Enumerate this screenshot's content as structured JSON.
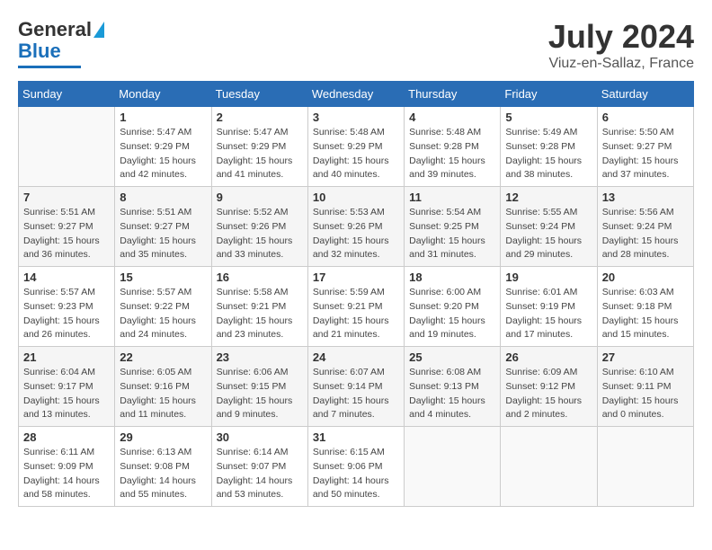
{
  "header": {
    "logo": {
      "line1": "General",
      "line2": "Blue"
    },
    "title": "July 2024",
    "location": "Viuz-en-Sallaz, France"
  },
  "days_of_week": [
    "Sunday",
    "Monday",
    "Tuesday",
    "Wednesday",
    "Thursday",
    "Friday",
    "Saturday"
  ],
  "weeks": [
    [
      {
        "day": "",
        "info": ""
      },
      {
        "day": "1",
        "info": "Sunrise: 5:47 AM\nSunset: 9:29 PM\nDaylight: 15 hours\nand 42 minutes."
      },
      {
        "day": "2",
        "info": "Sunrise: 5:47 AM\nSunset: 9:29 PM\nDaylight: 15 hours\nand 41 minutes."
      },
      {
        "day": "3",
        "info": "Sunrise: 5:48 AM\nSunset: 9:29 PM\nDaylight: 15 hours\nand 40 minutes."
      },
      {
        "day": "4",
        "info": "Sunrise: 5:48 AM\nSunset: 9:28 PM\nDaylight: 15 hours\nand 39 minutes."
      },
      {
        "day": "5",
        "info": "Sunrise: 5:49 AM\nSunset: 9:28 PM\nDaylight: 15 hours\nand 38 minutes."
      },
      {
        "day": "6",
        "info": "Sunrise: 5:50 AM\nSunset: 9:27 PM\nDaylight: 15 hours\nand 37 minutes."
      }
    ],
    [
      {
        "day": "7",
        "info": "Sunrise: 5:51 AM\nSunset: 9:27 PM\nDaylight: 15 hours\nand 36 minutes."
      },
      {
        "day": "8",
        "info": "Sunrise: 5:51 AM\nSunset: 9:27 PM\nDaylight: 15 hours\nand 35 minutes."
      },
      {
        "day": "9",
        "info": "Sunrise: 5:52 AM\nSunset: 9:26 PM\nDaylight: 15 hours\nand 33 minutes."
      },
      {
        "day": "10",
        "info": "Sunrise: 5:53 AM\nSunset: 9:26 PM\nDaylight: 15 hours\nand 32 minutes."
      },
      {
        "day": "11",
        "info": "Sunrise: 5:54 AM\nSunset: 9:25 PM\nDaylight: 15 hours\nand 31 minutes."
      },
      {
        "day": "12",
        "info": "Sunrise: 5:55 AM\nSunset: 9:24 PM\nDaylight: 15 hours\nand 29 minutes."
      },
      {
        "day": "13",
        "info": "Sunrise: 5:56 AM\nSunset: 9:24 PM\nDaylight: 15 hours\nand 28 minutes."
      }
    ],
    [
      {
        "day": "14",
        "info": "Sunrise: 5:57 AM\nSunset: 9:23 PM\nDaylight: 15 hours\nand 26 minutes."
      },
      {
        "day": "15",
        "info": "Sunrise: 5:57 AM\nSunset: 9:22 PM\nDaylight: 15 hours\nand 24 minutes."
      },
      {
        "day": "16",
        "info": "Sunrise: 5:58 AM\nSunset: 9:21 PM\nDaylight: 15 hours\nand 23 minutes."
      },
      {
        "day": "17",
        "info": "Sunrise: 5:59 AM\nSunset: 9:21 PM\nDaylight: 15 hours\nand 21 minutes."
      },
      {
        "day": "18",
        "info": "Sunrise: 6:00 AM\nSunset: 9:20 PM\nDaylight: 15 hours\nand 19 minutes."
      },
      {
        "day": "19",
        "info": "Sunrise: 6:01 AM\nSunset: 9:19 PM\nDaylight: 15 hours\nand 17 minutes."
      },
      {
        "day": "20",
        "info": "Sunrise: 6:03 AM\nSunset: 9:18 PM\nDaylight: 15 hours\nand 15 minutes."
      }
    ],
    [
      {
        "day": "21",
        "info": "Sunrise: 6:04 AM\nSunset: 9:17 PM\nDaylight: 15 hours\nand 13 minutes."
      },
      {
        "day": "22",
        "info": "Sunrise: 6:05 AM\nSunset: 9:16 PM\nDaylight: 15 hours\nand 11 minutes."
      },
      {
        "day": "23",
        "info": "Sunrise: 6:06 AM\nSunset: 9:15 PM\nDaylight: 15 hours\nand 9 minutes."
      },
      {
        "day": "24",
        "info": "Sunrise: 6:07 AM\nSunset: 9:14 PM\nDaylight: 15 hours\nand 7 minutes."
      },
      {
        "day": "25",
        "info": "Sunrise: 6:08 AM\nSunset: 9:13 PM\nDaylight: 15 hours\nand 4 minutes."
      },
      {
        "day": "26",
        "info": "Sunrise: 6:09 AM\nSunset: 9:12 PM\nDaylight: 15 hours\nand 2 minutes."
      },
      {
        "day": "27",
        "info": "Sunrise: 6:10 AM\nSunset: 9:11 PM\nDaylight: 15 hours\nand 0 minutes."
      }
    ],
    [
      {
        "day": "28",
        "info": "Sunrise: 6:11 AM\nSunset: 9:09 PM\nDaylight: 14 hours\nand 58 minutes."
      },
      {
        "day": "29",
        "info": "Sunrise: 6:13 AM\nSunset: 9:08 PM\nDaylight: 14 hours\nand 55 minutes."
      },
      {
        "day": "30",
        "info": "Sunrise: 6:14 AM\nSunset: 9:07 PM\nDaylight: 14 hours\nand 53 minutes."
      },
      {
        "day": "31",
        "info": "Sunrise: 6:15 AM\nSunset: 9:06 PM\nDaylight: 14 hours\nand 50 minutes."
      },
      {
        "day": "",
        "info": ""
      },
      {
        "day": "",
        "info": ""
      },
      {
        "day": "",
        "info": ""
      }
    ]
  ]
}
